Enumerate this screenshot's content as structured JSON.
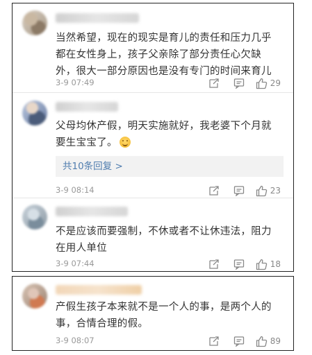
{
  "comments": [
    {
      "text_lines": [
        "当然希望，现在的现实是育儿的责任和压力几乎",
        "都在女性身上，孩子父亲除了部分责任心欠缺",
        "外，很大一部分原因也是没有专门的时间来育儿"
      ],
      "time": "3-9 07:49",
      "likes": "29"
    },
    {
      "text_lines": [
        "父母均休产假，明天实施就好，我老婆下个月就",
        "要生宝宝了。"
      ],
      "emoji": "smile",
      "replies_label": "共10条回复 >",
      "time": "3-9 08:14",
      "likes": "23"
    },
    {
      "text_lines": [
        "不是应该而要强制，不休或者不让休违法，阻力",
        "在用人单位"
      ],
      "time": "3-9 07:44",
      "likes": "18"
    },
    {
      "text_lines": [
        "产假生孩子本来就不是一个人的事，是两个人的",
        "事，合情合理的假。"
      ],
      "time": "3-9 08:07",
      "likes": "89"
    }
  ],
  "icons": {
    "forward": "share-icon",
    "comment": "comment-icon",
    "like": "thumbs-up-icon"
  }
}
